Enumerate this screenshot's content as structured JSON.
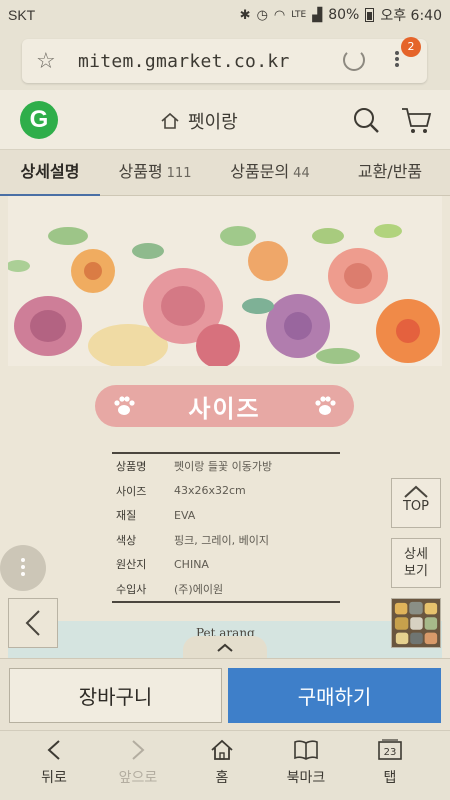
{
  "status_bar": {
    "carrier": "SKT",
    "battery": "80%",
    "time": "오후 6:40",
    "network": "LTE"
  },
  "browser": {
    "url": "mitem.gmarket.co.kr",
    "tab_badge": "2"
  },
  "site_header": {
    "logo": "G",
    "store_name": "펫이랑"
  },
  "tabs": [
    {
      "label": "상세설명",
      "count": ""
    },
    {
      "label": "상품평",
      "count": "111"
    },
    {
      "label": "상품문의",
      "count": "44"
    },
    {
      "label": "교환/반품",
      "count": ""
    }
  ],
  "content": {
    "size_title": "사이즈",
    "spec_rows": [
      {
        "key": "상품명",
        "value": "펫이랑 들꽃 이동가방"
      },
      {
        "key": "사이즈",
        "value": "43x26x32cm"
      },
      {
        "key": "재질",
        "value": "EVA"
      },
      {
        "key": "색상",
        "value": "핑크, 그레이, 베이지"
      },
      {
        "key": "원산지",
        "value": "CHINA"
      },
      {
        "key": "수입사",
        "value": "(주)에이원"
      }
    ],
    "peek_text": "Pet arang"
  },
  "side": {
    "top_label": "TOP",
    "detail_label_1": "상세",
    "detail_label_2": "보기"
  },
  "actions": {
    "cart_label": "장바구니",
    "buy_label": "구매하기"
  },
  "colors": {
    "buy": "#3e7fc9",
    "pill": "#e7a8a4",
    "logo": "#2fae4a",
    "badge": "#e5642a"
  },
  "bottom_nav": [
    {
      "label": "뒤로",
      "icon": "back-arrow-icon"
    },
    {
      "label": "앞으로",
      "icon": "forward-arrow-icon"
    },
    {
      "label": "홈",
      "icon": "home-icon"
    },
    {
      "label": "북마크",
      "icon": "bookmark-icon"
    },
    {
      "label": "탭",
      "icon": "tabs-icon",
      "count": "23"
    }
  ]
}
